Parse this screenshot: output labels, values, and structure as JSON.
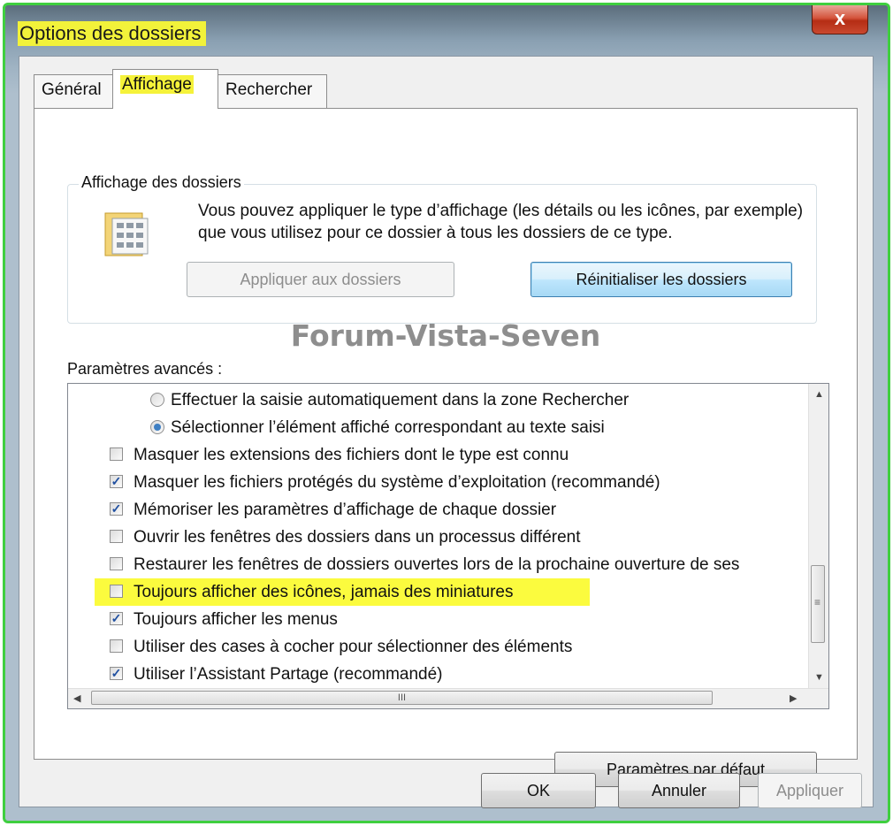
{
  "window": {
    "title": "Options des dossiers",
    "close_glyph": "x"
  },
  "tabs": [
    {
      "label": "Général",
      "active": false
    },
    {
      "label": "Affichage",
      "active": true
    },
    {
      "label": "Rechercher",
      "active": false
    }
  ],
  "folder_views": {
    "group_title": "Affichage des dossiers",
    "description": "Vous pouvez appliquer le type d’affichage (les détails ou les icônes, par exemple) que vous utilisez pour ce dossier à tous les dossiers de ce type.",
    "apply_button": "Appliquer aux dossiers",
    "reset_button": "Réinitialiser les dossiers",
    "icon": "folder-view-icon"
  },
  "watermark": "Forum-Vista-Seven",
  "advanced": {
    "label": "Paramètres avancés :",
    "items": [
      {
        "type": "radio",
        "checked": false,
        "label": "Effectuer la saisie automatiquement dans la zone Rechercher"
      },
      {
        "type": "radio",
        "checked": true,
        "label": "Sélectionner l’élément affiché correspondant au texte saisi"
      },
      {
        "type": "checkbox",
        "checked": false,
        "label": "Masquer les extensions des fichiers dont le type est connu"
      },
      {
        "type": "checkbox",
        "checked": true,
        "label": "Masquer les fichiers protégés du système d’exploitation (recommandé)"
      },
      {
        "type": "checkbox",
        "checked": true,
        "label": "Mémoriser les paramètres d’affichage de chaque dossier"
      },
      {
        "type": "checkbox",
        "checked": false,
        "label": "Ouvrir les fenêtres des dossiers dans un processus différent"
      },
      {
        "type": "checkbox",
        "checked": false,
        "label": "Restaurer les fenêtres de dossiers ouvertes lors de la prochaine ouverture de ses"
      },
      {
        "type": "checkbox",
        "checked": false,
        "label": "Toujours afficher des icônes, jamais des miniatures",
        "highlighted": true
      },
      {
        "type": "checkbox",
        "checked": true,
        "label": "Toujours afficher les menus"
      },
      {
        "type": "checkbox",
        "checked": false,
        "label": "Utiliser des cases à cocher pour sélectionner des éléments"
      },
      {
        "type": "checkbox",
        "checked": true,
        "label": "Utiliser l’Assistant Partage (recommandé)"
      }
    ],
    "hscroll_thumb_glyph": "III",
    "vscroll_thumb_glyph": "≡"
  },
  "defaults_button": "Paramètres par défaut",
  "footer": {
    "ok": "OK",
    "cancel": "Annuler",
    "apply": "Appliquer"
  },
  "colors": {
    "highlight": "#f5f23a",
    "window_border": "#3fcf3f",
    "close_red": "#c9482f"
  }
}
